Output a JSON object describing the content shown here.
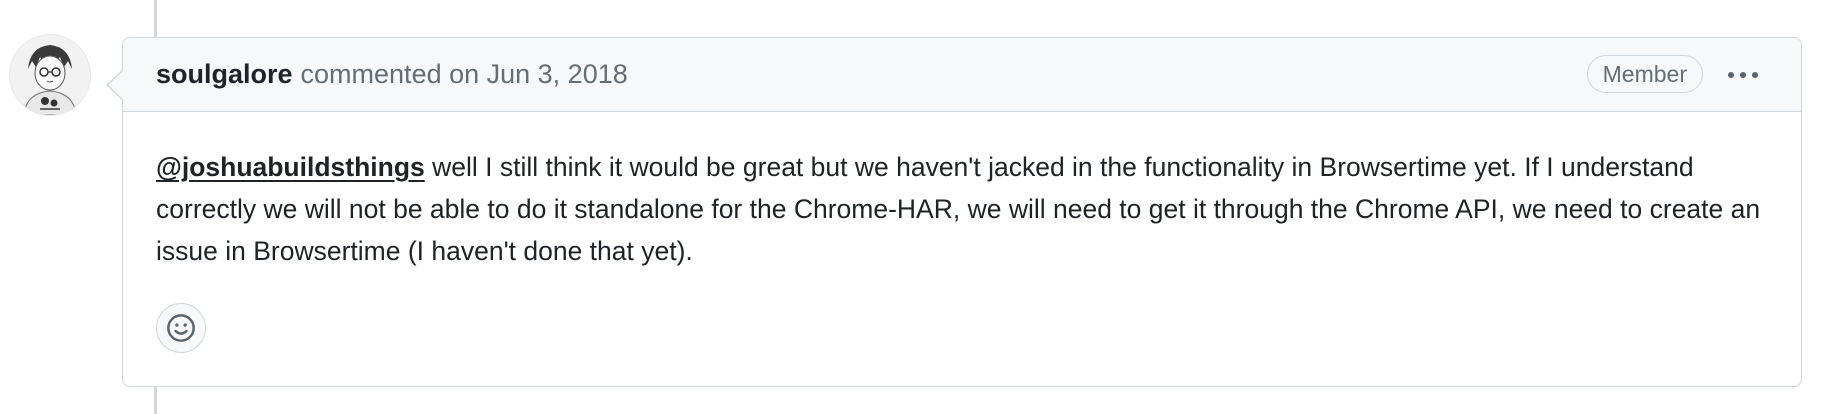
{
  "comment": {
    "author": "soulgalore",
    "action": "commented on Jun 3, 2018",
    "badge": "Member",
    "mention": "@joshuabuildsthings",
    "body": " well I still think it would be great but we haven't jacked in the functionality in Browsertime yet. If I understand correctly we will not be able to do it standalone for the Chrome-HAR, we will need to get it through the Chrome API, we need to create an issue in Browsertime (I haven't done that yet)."
  },
  "icons": {
    "avatar": "user-avatar-icon",
    "menu": "kebab-horizontal-icon",
    "reaction": "smiley-icon"
  },
  "colors": {
    "border": "#d0d7de",
    "header_bg": "#f6f8fa",
    "muted_text": "#656d76",
    "text": "#1f2328"
  }
}
